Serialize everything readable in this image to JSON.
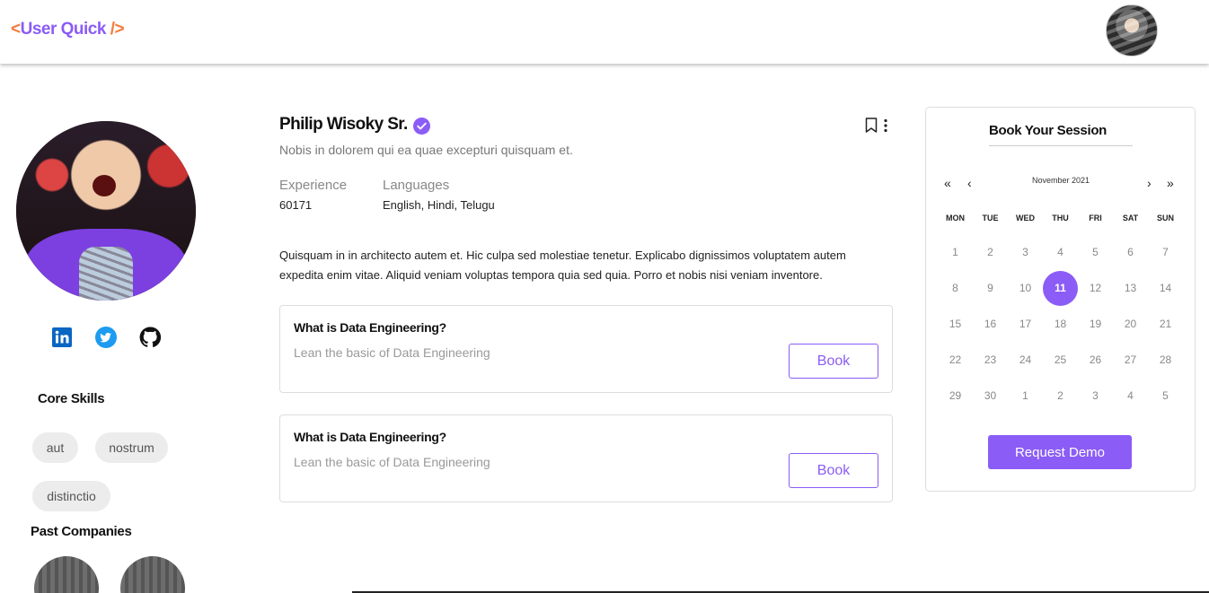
{
  "header": {
    "logo_open": "<",
    "logo_name": "User Quick",
    "logo_close": " />"
  },
  "colors": {
    "accent": "#8b5cf6",
    "logo_bracket": "#f47b3b"
  },
  "profile": {
    "name": "Philip Wisoky Sr.",
    "tagline": "Nobis in dolorem qui ea quae excepturi quisquam et.",
    "experience_label": "Experience",
    "experience_value": "60171",
    "languages_label": "Languages",
    "languages_value": "English, Hindi, Telugu",
    "bio": "Quisquam in in architecto autem et. Hic culpa sed molestiae tenetur. Explicabo dignissimos voluptatem autem expedita enim vitae. Aliquid veniam voluptas tempora quia sed quia. Porro et nobis nisi veniam inventore."
  },
  "social": [
    "linkedin-icon",
    "twitter-icon",
    "github-icon"
  ],
  "core_skills": {
    "title": "Core Skills",
    "items": [
      "aut",
      "nostrum",
      "distinctio"
    ]
  },
  "past_companies": {
    "title": "Past Companies"
  },
  "sessions": [
    {
      "title": "What is Data Engineering?",
      "subtitle": "Lean the basic of Data Engineering",
      "button": "Book"
    },
    {
      "title": "What is Data Engineering?",
      "subtitle": "Lean the basic of Data Engineering",
      "button": "Book"
    }
  ],
  "booking": {
    "title": "Book Your Session",
    "nav": [
      "«",
      "‹",
      "›",
      "»"
    ],
    "month": "November 2021",
    "weekdays": [
      "MON",
      "TUE",
      "WED",
      "THU",
      "FRI",
      "SAT",
      "SUN"
    ],
    "weeks": [
      [
        "1",
        "2",
        "3",
        "4",
        "5",
        "6",
        "7"
      ],
      [
        "8",
        "9",
        "10",
        "11",
        "12",
        "13",
        "14"
      ],
      [
        "15",
        "16",
        "17",
        "18",
        "19",
        "20",
        "21"
      ],
      [
        "22",
        "23",
        "24",
        "25",
        "26",
        "27",
        "28"
      ],
      [
        "29",
        "30",
        "1",
        "2",
        "3",
        "4",
        "5"
      ]
    ],
    "selected": "11",
    "button": "Request Demo"
  }
}
